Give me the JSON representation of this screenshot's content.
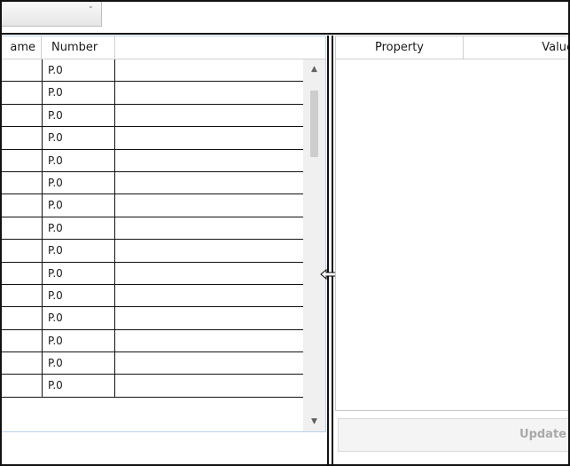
{
  "grid": {
    "columns": {
      "name": "ame",
      "number": "Number"
    },
    "rows": [
      "P.0",
      "P.0",
      "P.0",
      "P.0",
      "P.0",
      "P.0",
      "P.0",
      "P.0",
      "P.0",
      "P.0",
      "P.0",
      "P.0",
      "P.0",
      "P.0",
      "P.0"
    ]
  },
  "properties": {
    "columns": {
      "property": "Property",
      "value": "Value"
    },
    "update_label": "Update"
  },
  "icons": {
    "dropdown": "chevron-down-icon",
    "scroll_up": "scroll-up-icon",
    "scroll_down": "scroll-down-icon",
    "splitter_cursor": "resize-horizontal-icon"
  }
}
